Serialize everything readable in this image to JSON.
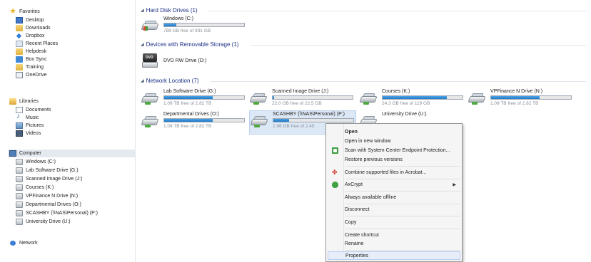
{
  "sidebar": {
    "favorites_label": "Favorites",
    "favorites": [
      {
        "label": "Desktop",
        "icon": "desktop-icon"
      },
      {
        "label": "Downloads",
        "icon": "folder-icon"
      },
      {
        "label": "Dropbox",
        "icon": "dropbox-icon"
      },
      {
        "label": "Recent Places",
        "icon": "recent-places-icon"
      },
      {
        "label": "Helpdesk",
        "icon": "folder-icon"
      },
      {
        "label": "Box Sync",
        "icon": "box-sync-icon"
      },
      {
        "label": "Training",
        "icon": "folder-icon"
      },
      {
        "label": "OneDrive",
        "icon": "onedrive-icon"
      }
    ],
    "libraries_label": "Libraries",
    "libraries": [
      {
        "label": "Documents",
        "icon": "documents-icon"
      },
      {
        "label": "Music",
        "icon": "music-icon"
      },
      {
        "label": "Pictures",
        "icon": "pictures-icon"
      },
      {
        "label": "Videos",
        "icon": "videos-icon"
      }
    ],
    "computer_label": "Computer",
    "computer": [
      {
        "label": "Windows (C:)",
        "icon": "local-drive-icon"
      },
      {
        "label": "Lab Software Drive (G:)",
        "icon": "network-drive-icon"
      },
      {
        "label": "Scanned Image Drive (J:)",
        "icon": "network-drive-icon"
      },
      {
        "label": "Courses (K:)",
        "icon": "network-drive-icon"
      },
      {
        "label": "VPFinance N Drive (N:)",
        "icon": "network-drive-icon"
      },
      {
        "label": "Departmental Drives (O:)",
        "icon": "network-drive-icon"
      },
      {
        "label": "SCASHBY (\\\\NAS\\Personal) (P:)",
        "icon": "network-drive-icon"
      },
      {
        "label": "University Drive (U:)",
        "icon": "network-drive-icon"
      }
    ],
    "network_label": "Network"
  },
  "groups": {
    "hard_disk": {
      "title": "Hard Disk Drives (1)",
      "drives": [
        {
          "name": "Windows (C:)",
          "free": "789 GB free of 931 GB",
          "used_fraction": 0.15
        }
      ]
    },
    "removable": {
      "title": "Devices with Removable Storage (1)",
      "drives": [
        {
          "name": "DVD RW Drive (D:)",
          "icon_text": "DVD"
        }
      ]
    },
    "network": {
      "title": "Network Location (7)",
      "drives": [
        {
          "name": "Lab Software Drive (G:)",
          "free": "1.09 TB free of 2.82 TB",
          "used_fraction": 0.61
        },
        {
          "name": "Scanned Image Drive (J:)",
          "free": "22.0 GB free of 22.5 GB",
          "used_fraction": 0.02
        },
        {
          "name": "Courses (K:)",
          "free": "24.3 GB free of 119 GB",
          "used_fraction": 0.8
        },
        {
          "name": "VPFinance N Drive (N:)",
          "free": "1.09 TB free of 2.82 TB",
          "used_fraction": 0.61
        },
        {
          "name": "Departmental Drives (O:)",
          "free": "1.09 TB free of 2.82 TB",
          "used_fraction": 0.61
        },
        {
          "name": "SCASHBY (\\\\NAS\\Personal) (P:)",
          "free": "1.96 GB free of 2.45",
          "used_fraction": 0.2,
          "selected": true
        },
        {
          "name": "University Drive (U:)",
          "free": "",
          "used_fraction": 0
        }
      ]
    }
  },
  "context_menu": {
    "items": [
      {
        "label": "Open",
        "bold": true
      },
      {
        "label": "Open in new window"
      },
      {
        "label": "Scan with System Center Endpoint Protection...",
        "icon": "shield-scan-icon"
      },
      {
        "label": "Restore previous versions"
      },
      {
        "label": "Combine supported files in Acrobat...",
        "icon": "acrobat-icon"
      },
      {
        "label": "AxCrypt",
        "icon": "axcrypt-icon",
        "submenu": true
      },
      {
        "label": "Always available offline"
      },
      {
        "label": "Disconnect"
      },
      {
        "label": "Copy"
      },
      {
        "label": "Create shortcut"
      },
      {
        "label": "Rename"
      },
      {
        "label": "Properties",
        "highlighted": true
      }
    ],
    "submenu_arrow": "▶"
  },
  "colors": {
    "group_header": "#1e3287",
    "bar_fill": "#2379c9",
    "selection": "#dde8f6",
    "menu_highlight": "#e7eef9"
  }
}
